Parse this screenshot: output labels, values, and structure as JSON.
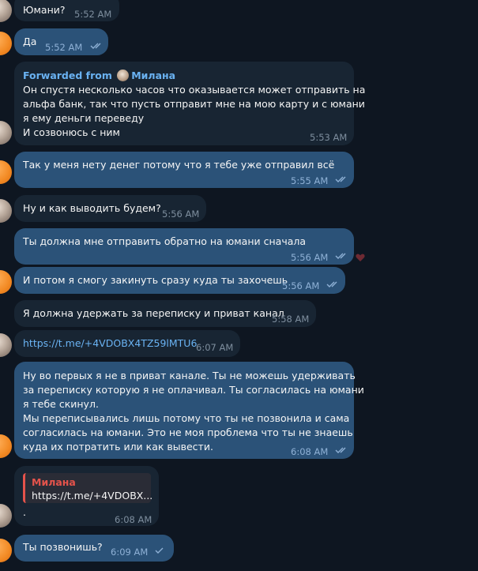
{
  "messages": [
    {
      "text": "Юмани?",
      "time": "5:52 AM"
    },
    {
      "text": "Да",
      "time": "5:52 AM"
    },
    {
      "forwarded_prefix": "Forwarded from",
      "forwarded_name": "Милана",
      "lines": [
        "Он спустя несколько часов что оказывается может отправить на",
        "альфа банк, так что пусть отправит мне на мою карту и с юмани",
        "я ему деньги переведу",
        "И созвонюсь с ним"
      ],
      "time": "5:53 AM"
    },
    {
      "text": "Так у меня нету денег потому что я тебе уже отправил всё",
      "time": "5:55 AM"
    },
    {
      "text": "Ну и как выводить будем?",
      "time": "5:56 AM"
    },
    {
      "text": "Ты должна мне отправить обратно на юмани сначала",
      "time": "5:56 AM"
    },
    {
      "text": "И потом я смогу закинуть сразу куда ты захочешь",
      "time": "5:56 AM"
    },
    {
      "text": "Я должна удержать за переписку и приват канал",
      "time": "5:58 AM"
    },
    {
      "text": "https://t.me/+4VDOBX4TZ59lMTU6",
      "time": "6:07 AM"
    },
    {
      "lines": [
        "Ну во первых я не в приват канале. Ты не можешь удерживать",
        "за переписку которую я не оплачивал. Ты согласилась на юмани",
        "я тебе скинул.",
        "Мы переписывались лишь потому что ты не позвонила и сама",
        "согласилась на юмани. Это не моя проблема что ты не знаешь",
        "куда их потратить или как вывести."
      ],
      "time": "6:08 AM"
    },
    {
      "reply_name": "Милана",
      "reply_text": "https://t.me/+4VDOBX...",
      "text": ".",
      "time": "6:08 AM"
    },
    {
      "text": "Ты позвонишь?",
      "time": "6:09 AM"
    }
  ],
  "icons": {
    "read": "double-check-icon",
    "sent": "single-check-icon",
    "reaction": "heart-icon"
  },
  "colors": {
    "background": "#0e1621",
    "incoming": "#182533",
    "outgoing": "#2b5278",
    "link": "#6ab3f3",
    "forward": "#6ab2f2",
    "reply_accent": "#e5534b"
  }
}
